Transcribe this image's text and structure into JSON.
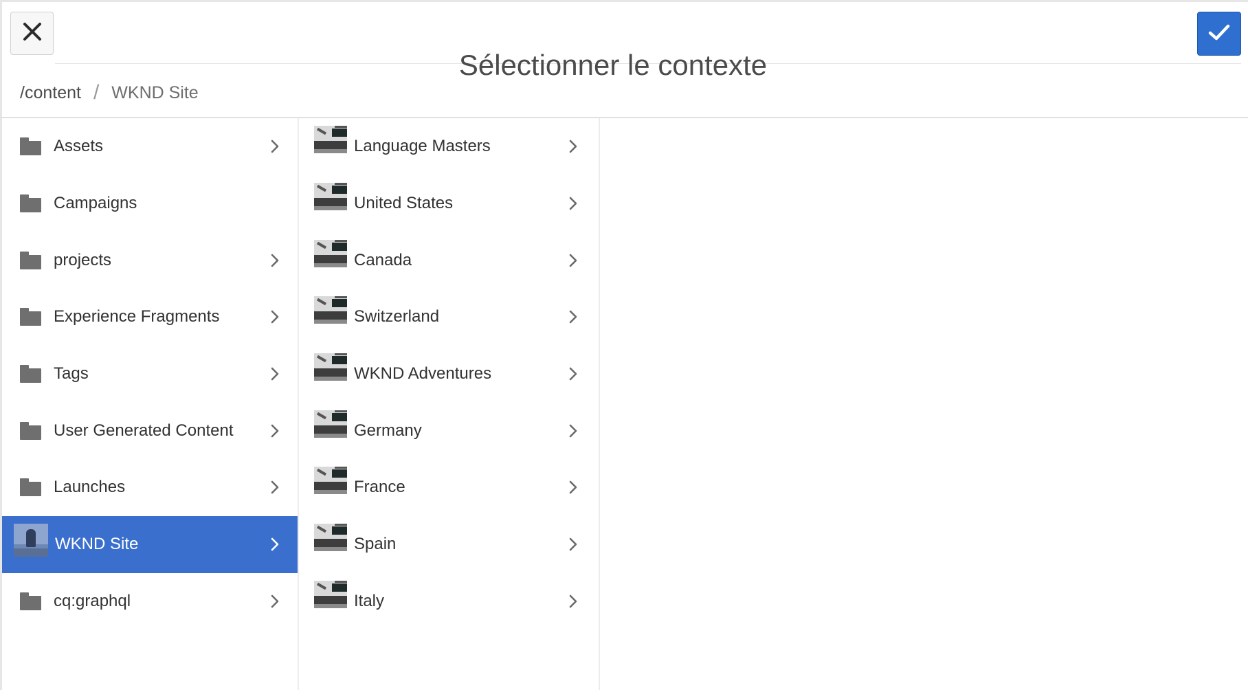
{
  "dialog": {
    "title": "Sélectionner le contexte",
    "close_icon": "close-icon",
    "confirm_icon": "checkmark-icon",
    "accent_color": "#3a6fcd"
  },
  "breadcrumb": {
    "root": "/content",
    "current": "WKND Site"
  },
  "column1": {
    "items": [
      {
        "label": "Assets",
        "icon": "folder-icon",
        "has_children": true,
        "selected": false
      },
      {
        "label": "Campaigns",
        "icon": "folder-icon",
        "has_children": false,
        "selected": false
      },
      {
        "label": "projects",
        "icon": "folder-icon",
        "has_children": true,
        "selected": false
      },
      {
        "label": "Experience Fragments",
        "icon": "folder-icon",
        "has_children": true,
        "selected": false
      },
      {
        "label": "Tags",
        "icon": "folder-icon",
        "has_children": true,
        "selected": false
      },
      {
        "label": "User Generated Content",
        "icon": "folder-icon",
        "has_children": true,
        "selected": false
      },
      {
        "label": "Launches",
        "icon": "folder-icon",
        "has_children": true,
        "selected": false
      },
      {
        "label": "WKND Site",
        "icon": "site-thumbnail-icon",
        "has_children": true,
        "selected": true
      },
      {
        "label": "cq:graphql",
        "icon": "folder-icon",
        "has_children": true,
        "selected": false
      }
    ]
  },
  "column2": {
    "items": [
      {
        "label": "Language Masters",
        "icon": "page-thumbnail-icon",
        "has_children": true
      },
      {
        "label": "United States",
        "icon": "page-thumbnail-icon",
        "has_children": true
      },
      {
        "label": "Canada",
        "icon": "page-thumbnail-icon",
        "has_children": true
      },
      {
        "label": "Switzerland",
        "icon": "page-thumbnail-icon",
        "has_children": true
      },
      {
        "label": "WKND Adventures",
        "icon": "page-thumbnail-icon",
        "has_children": true
      },
      {
        "label": "Germany",
        "icon": "page-thumbnail-icon",
        "has_children": true
      },
      {
        "label": "France",
        "icon": "page-thumbnail-icon",
        "has_children": true
      },
      {
        "label": "Spain",
        "icon": "page-thumbnail-icon",
        "has_children": true
      },
      {
        "label": "Italy",
        "icon": "page-thumbnail-icon",
        "has_children": true
      }
    ]
  }
}
